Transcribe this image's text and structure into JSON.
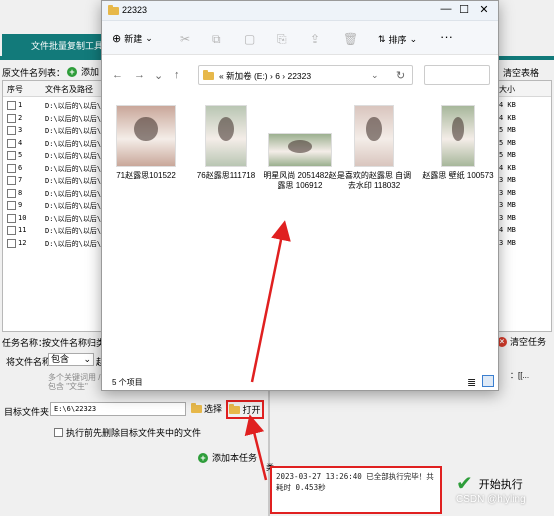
{
  "app": {
    "tab_label": "文件批量复制工具",
    "source_list_label": "原文件名列表：",
    "add_file_label": "添加",
    "clear_table_label": "清空表格",
    "columns": {
      "index": "序号",
      "path": "文件名及路径",
      "size": "大小"
    },
    "rows": [
      {
        "index": "1",
        "path": "D:\\以后的\\以后\\",
        "size": "4 KB"
      },
      {
        "index": "2",
        "path": "D:\\以后的\\以后\\",
        "size": "4 KB"
      },
      {
        "index": "3",
        "path": "D:\\以后的\\以后\\",
        "size": "5 MB"
      },
      {
        "index": "4",
        "path": "D:\\以后的\\以后\\",
        "size": "5 MB"
      },
      {
        "index": "5",
        "path": "D:\\以后的\\以后\\",
        "size": "5 MB"
      },
      {
        "index": "6",
        "path": "D:\\以后的\\以后\\",
        "size": "4 KB"
      },
      {
        "index": "7",
        "path": "D:\\以后的\\以后\\",
        "size": "3 MB"
      },
      {
        "index": "8",
        "path": "D:\\以后的\\以后\\",
        "size": "3 MB"
      },
      {
        "index": "9",
        "path": "D:\\以后的\\以后\\",
        "size": "3 MB"
      },
      {
        "index": "10",
        "path": "D:\\以后的\\以后\\",
        "size": "3 MB"
      },
      {
        "index": "11",
        "path": "D:\\以后的\\以后\\",
        "size": "4 MB"
      },
      {
        "index": "12",
        "path": "D:\\以后的\\以后\\",
        "size": "3 MB"
      }
    ],
    "task_name_label": "任务名称：",
    "task_name_value": "按文件名称归类",
    "clear_task_label": "清空任务",
    "filename_label": "将文件名称",
    "contains_value": "包含",
    "keyword_prefix": "赵",
    "hint_line1": "多个关键词用 /",
    "hint_line2": "包含 \"文生\"",
    "right_fragment": "：[[...",
    "target_folder_label": "目标文件夹：",
    "target_folder_value": "E:\\6\\22323",
    "choose_label": "选择",
    "open_label": "打开",
    "delete_before_label": "执行前先删除目标文件夹中的文件",
    "add_task_label": "添加本任务",
    "log_side": "类",
    "log_text": "2023-03-27 13:26:40 已全部执行完毕！共耗时 0.453秒",
    "execute_label": "开始执行",
    "watermark": "CSDN @hlyling"
  },
  "explorer": {
    "title": "22323",
    "new_label": "新建",
    "sort_label": "排序",
    "more_label": "···",
    "breadcrumb": "«  新加卷 (E:)  ›  6  ›  22323",
    "status": "5 个项目",
    "items": [
      {
        "name": "71赵露思101522",
        "color": "#c9a79a"
      },
      {
        "name": "76赵露思111718",
        "color": "#b9c6b3"
      },
      {
        "name": "明星风尚 2051482赵露思 106912",
        "color": "#9bb08f"
      },
      {
        "name": "是喜欢的赵露思 自调  去水印 118032",
        "color": "#d9c5be"
      },
      {
        "name": "赵露思 壁纸 100573",
        "color": "#a7b79b"
      }
    ]
  }
}
